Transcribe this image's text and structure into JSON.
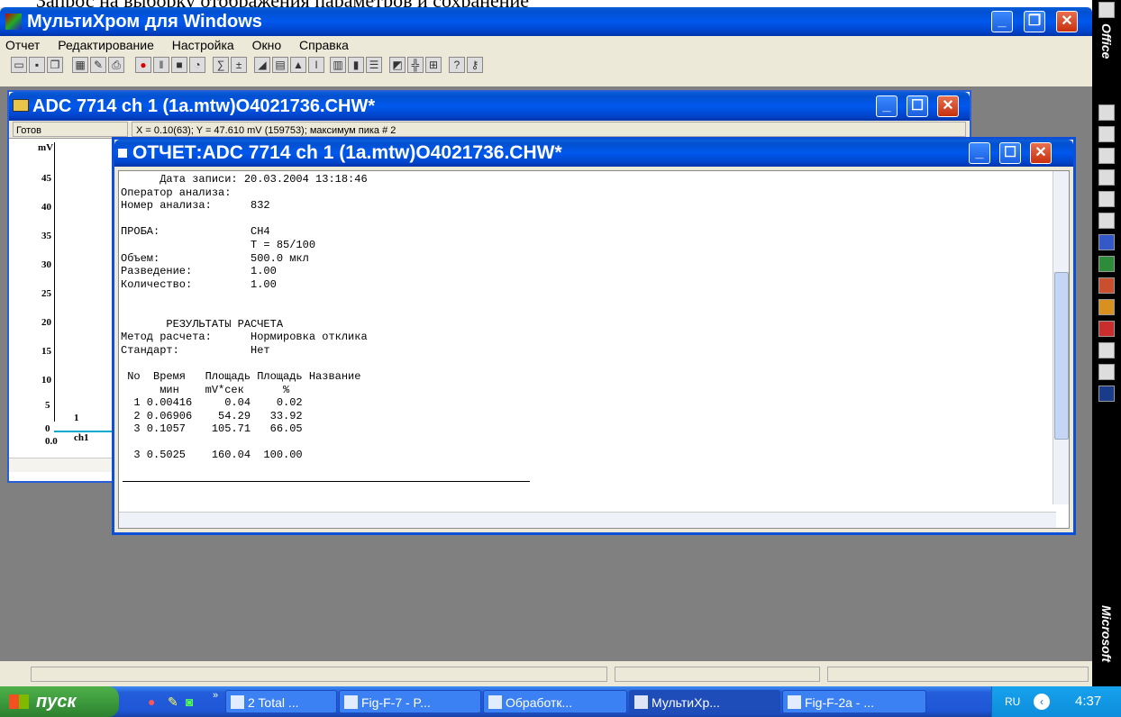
{
  "doc_top_text": "Запрос на выборку отображения параметров и сохранение",
  "app": {
    "title": "МультиХром для Windows",
    "menu": [
      "Отчет",
      "Редактирование",
      "Настройка",
      "Окно",
      "Справка"
    ]
  },
  "chrom_window": {
    "title": "ADC 7714 ch 1 (1a.mtw)O4021736.CHW*",
    "status_ready": "Готов",
    "status_info": "X = 0.10(63); Y = 47.610 mV (159753); максимум пика # 2",
    "y_unit": "mV",
    "y_ticks": [
      "45",
      "40",
      "35",
      "30",
      "25",
      "20",
      "15",
      "10",
      "5",
      "0"
    ],
    "x_start": "0.0",
    "peak_label": "1",
    "channel_label": "ch1"
  },
  "report_window": {
    "title": "ОТЧЕТ:ADC 7714 ch 1 (1a.mtw)O4021736.CHW*",
    "lines": [
      "      Дата записи: 20.03.2004 13:18:46",
      "Оператор анализа:",
      "Номер анализа:      832",
      "",
      "ПРОБА:              CH4",
      "                    T = 85/100",
      "Объем:              500.0 мкл",
      "Разведение:         1.00",
      "Количество:         1.00",
      "",
      "",
      "       РЕЗУЛЬТАТЫ РАСЧЕТА",
      "Метод расчета:      Нормировка отклика",
      "Стандарт:           Нет",
      "",
      " No  Время   Площадь Площадь Название",
      "      мин    mV*сек      %",
      "  1 0.00416     0.04    0.02",
      "  2 0.06906    54.29   33.92",
      "  3 0.1057    105.71   66.05",
      "",
      "  3 0.5025    160.04  100.00"
    ]
  },
  "taskbar": {
    "start": "пуск",
    "tasks": [
      "2 Total ...",
      "Fig-F-7 - P...",
      "Обработк...",
      "МультиХр...",
      "Fig-F-2a - ..."
    ],
    "lang": "RU",
    "time": "4:37"
  },
  "office_bar": {
    "top_label": "Office",
    "bottom_label": "Microsoft"
  }
}
